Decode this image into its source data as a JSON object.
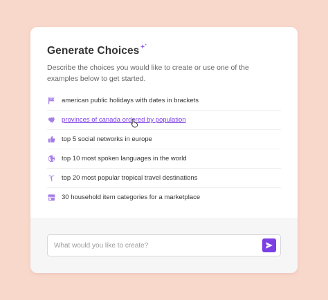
{
  "card": {
    "title": "Generate Choices",
    "title_icon": "sparkle-icon",
    "subtitle": "Describe the choices you would like to create or use one of the examples below to get started."
  },
  "examples": [
    {
      "icon": "flag-icon",
      "label": "american public holidays with dates in brackets"
    },
    {
      "icon": "canada-map-icon",
      "label": "provinces of canada ordered by population",
      "hovered": true
    },
    {
      "icon": "thumbs-up-icon",
      "label": "top 5 social networks in europe"
    },
    {
      "icon": "globe-icon",
      "label": "top 10 most spoken languages in the world"
    },
    {
      "icon": "palm-tree-icon",
      "label": "top 20 most popular tropical travel destinations"
    },
    {
      "icon": "storefront-icon",
      "label": "30 household item categories for a marketplace"
    }
  ],
  "prompt": {
    "placeholder": "What would you like to create?",
    "value": "",
    "send_icon": "send-icon"
  },
  "colors": {
    "background": "#f9d8cc",
    "accent": "#7b3fe4",
    "icon": "#a47de8"
  }
}
